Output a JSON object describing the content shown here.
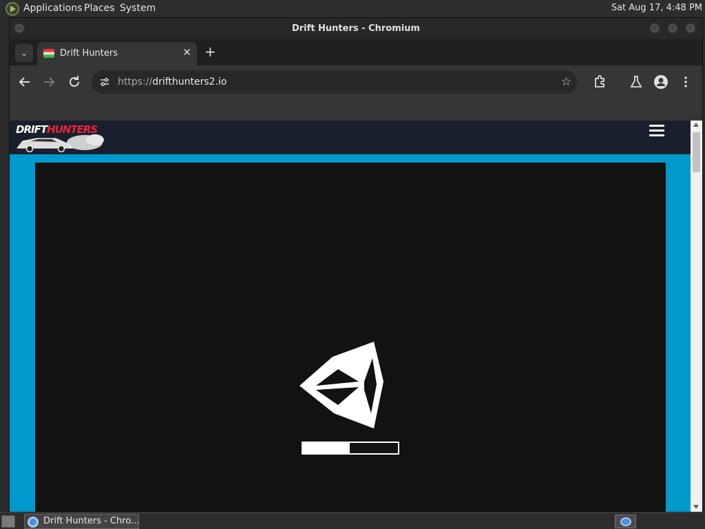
{
  "system_panel": {
    "menu": [
      "Applications",
      "Places",
      "System"
    ],
    "clock": "Sat Aug 17,  4:48 PM"
  },
  "window": {
    "title": "Drift Hunters - Chromium"
  },
  "browser": {
    "tab_title": "Drift Hunters",
    "url_scheme": "https://",
    "url_host": "drifthunters2.io"
  },
  "site": {
    "logo_text_1": "DRIFT",
    "logo_text_2": "HUNTERS"
  },
  "game": {
    "loading_progress": 0.49
  },
  "taskbar": {
    "window_label": "Drift Hunters - Chro..."
  },
  "colors": {
    "page_background": "#0099cc",
    "site_header": "#1a1f2e",
    "game_background": "#121212",
    "logo_accent": "#e8243a"
  },
  "icons": [
    "distro-icon",
    "chevron-down-icon",
    "close-icon",
    "plus-icon",
    "back-arrow-icon",
    "forward-arrow-icon",
    "reload-icon",
    "site-settings-icon",
    "star-icon",
    "extensions-icon",
    "lab-flask-icon",
    "profile-icon",
    "more-vert-icon",
    "hamburger-menu-icon",
    "unity-logo-icon",
    "chromium-icon"
  ]
}
